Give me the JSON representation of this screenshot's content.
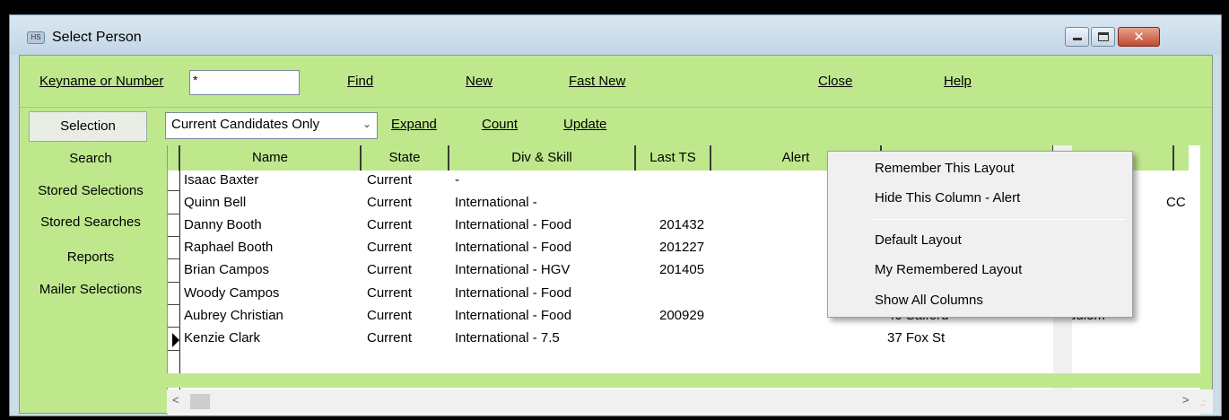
{
  "window": {
    "title": "Select Person",
    "controls": {
      "minimize": "minimize",
      "maximize": "maximize",
      "close": "✕"
    }
  },
  "toolbar": {
    "keyname_label": "Keyname or Number",
    "keyname_value": "*",
    "find": "Find",
    "new": "New",
    "fast_new": "Fast New",
    "close": "Close",
    "help": "Help"
  },
  "sidebar": {
    "items": [
      {
        "label": "Selection"
      },
      {
        "label": "Search"
      },
      {
        "label": "Stored Selections"
      },
      {
        "label": "Stored Searches"
      },
      {
        "label": "Reports"
      },
      {
        "label": "Mailer Selections"
      }
    ]
  },
  "filter": {
    "selected": "Current Candidates Only",
    "expand": "Expand",
    "count": "Count",
    "update": "Update"
  },
  "table": {
    "columns": [
      "Name",
      "State",
      "Div & Skill",
      "Last TS",
      "Alert"
    ],
    "rows": [
      {
        "name": "Isaac Baxter",
        "state": "Current",
        "div_skill": "-",
        "last_ts": "",
        "address": "",
        "town": ""
      },
      {
        "name": "Quinn Bell",
        "state": "Current",
        "div_skill": "International -",
        "last_ts": "",
        "address": "",
        "town": ""
      },
      {
        "name": "Danny Booth",
        "state": "Current",
        "div_skill": "International - Food",
        "last_ts": "201432",
        "address": "",
        "town": ""
      },
      {
        "name": "Raphael Booth",
        "state": "Current",
        "div_skill": "International - Food",
        "last_ts": "201227",
        "address": "",
        "town": ""
      },
      {
        "name": "Brian Campos",
        "state": "Current",
        "div_skill": "International - HGV",
        "last_ts": "201405",
        "address": "",
        "town": ""
      },
      {
        "name": "Woody Campos",
        "state": "Current",
        "div_skill": "International - Food",
        "last_ts": "",
        "address": "",
        "town": ""
      },
      {
        "name": "Aubrey Christian",
        "state": "Current",
        "div_skill": "International - Food",
        "last_ts": "200929",
        "address": "40 Salford",
        "town": "Audlem"
      },
      {
        "name": "Kenzie Clark",
        "state": "Current",
        "div_skill": "International - 7.5",
        "last_ts": "",
        "address": "37 Fox St",
        "town": ""
      }
    ],
    "clipped_right_text": "CC",
    "current_row_index": 7
  },
  "context_menu": {
    "items": [
      "Remember This Layout",
      "Hide This Column - Alert",
      "Default Layout",
      "My Remembered Layout",
      "Show All Columns"
    ]
  },
  "colors": {
    "panel_green": "#bfe88d",
    "title_bar": "#c9dae8",
    "close_red": "#c24a2e"
  }
}
